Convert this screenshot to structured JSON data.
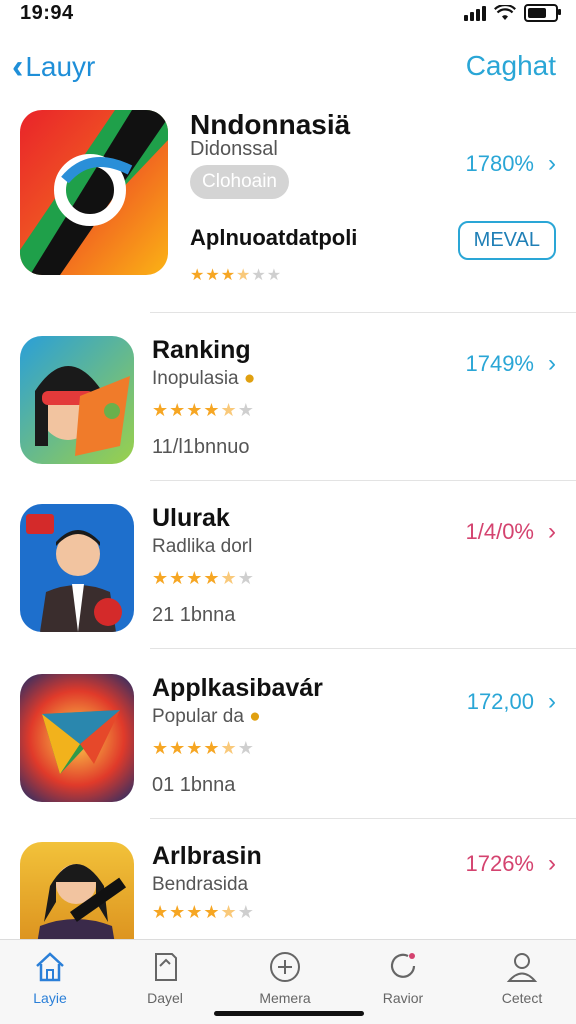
{
  "status_bar": {
    "time": "19:94"
  },
  "nav": {
    "back_label": "Lauyr",
    "right_label": "Caghat"
  },
  "featured": {
    "title": "Nndonnasiä",
    "subtitle": "Didonssal",
    "pill": "Clohoain",
    "desc": "Aplnuoatdatpoli",
    "price": "1780%",
    "button": "MEVAL",
    "rating_stars": 3.5
  },
  "apps": [
    {
      "title": "Ranking",
      "subtitle": "Inopulasia",
      "rating_stars": 4.5,
      "count": "11/l1bnnuo",
      "price": "1749%",
      "price_color": "#2aa6d6"
    },
    {
      "title": "Ulurak",
      "subtitle": "Radlika dorl",
      "rating_stars": 4.5,
      "count": "21 1bnna",
      "price": "1/4/0%",
      "price_color": "#d4436f"
    },
    {
      "title": "Applkasibavár",
      "subtitle": "Popular da",
      "rating_stars": 4.5,
      "count": "01 1bnna",
      "price": "172,00",
      "price_color": "#2aa6d6"
    },
    {
      "title": "Arlbrasin",
      "subtitle": "Bendrasida",
      "rating_stars": 4.5,
      "count": "",
      "price": "1726%",
      "price_color": "#d4436f"
    }
  ],
  "tabs": [
    {
      "label": "Layie"
    },
    {
      "label": "Dayel"
    },
    {
      "label": "Memera"
    },
    {
      "label": "Ravior"
    },
    {
      "label": "Cetect"
    }
  ]
}
